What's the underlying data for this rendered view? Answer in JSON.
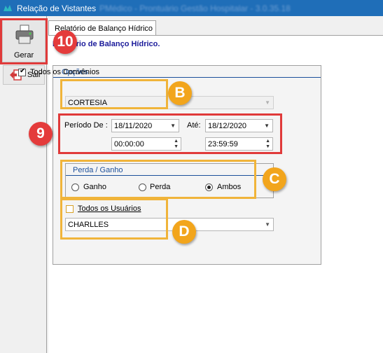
{
  "window": {
    "title": "Relação de Vistantes",
    "title_suffix": "PMédico - Prontuário Gestão Hospitalar - 3.0.35.18"
  },
  "toolbar": {
    "gerar_label": "Gerar",
    "sair_label": "Sair"
  },
  "tab": {
    "label": "Relatório de Balanço Hídrico"
  },
  "report": {
    "heading": "Relatório de Balanço Hídrico."
  },
  "opcoes": {
    "legend": "Opções",
    "todos_convenios_label": "Todos os Convênios",
    "todos_convenios_checked": true,
    "convenio_value": "CORTESIA",
    "periodo_label": "Período De :",
    "ate_label": "Até:",
    "date_from": "18/11/2020",
    "date_to": "18/12/2020",
    "time_from": "00:00:00",
    "time_to": "23:59:59"
  },
  "perda_ganho": {
    "legend": "Perda / Ganho",
    "options": [
      "Ganho",
      "Perda",
      "Ambos"
    ],
    "selected": "Ambos"
  },
  "usuarios": {
    "todos_usuarios_label": "Todos os Usuários",
    "todos_usuarios_checked": false,
    "usuario_value": "CHARLLES"
  },
  "annotations": {
    "badge_10": "10",
    "badge_9": "9",
    "badge_b": "B",
    "badge_c": "C",
    "badge_d": "D"
  },
  "colors": {
    "title_bar": "#1f6eb8",
    "highlight_orange": "#f0b43a",
    "highlight_red": "#e03a3a",
    "heading_blue": "#1a1a9a"
  }
}
